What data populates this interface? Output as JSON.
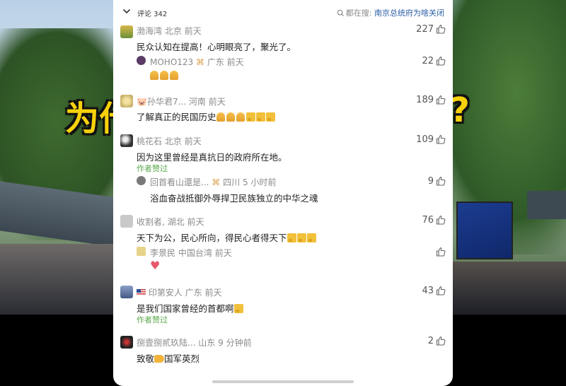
{
  "background": {
    "caption_left": "为什",
    "caption_right": "?"
  },
  "header": {
    "count_label": "评论 342",
    "search_label": "都在搜:",
    "search_term": "南京总统府为啥关闭"
  },
  "comments": [
    {
      "name": "渤海湾",
      "location": "北京",
      "time": "前天",
      "text": "民众认知在提高！心明眼亮了，聚光了。",
      "likes": "227",
      "reply": {
        "name": "MOHO123",
        "location": "广东",
        "time": "前天",
        "likes": "22"
      }
    },
    {
      "name": "🐷孙华君7...",
      "location": "河南",
      "time": "前天",
      "text": "了解真正的民国历史",
      "likes": "189"
    },
    {
      "name": "桃花石",
      "location": "北京",
      "time": "前天",
      "text": "因为这里曾经是真抗日的政府所在地。",
      "likes": "109",
      "author_liked": "作者赞过",
      "reply": {
        "name": "回首看山還是...",
        "location": "四川",
        "time": "5 小时前",
        "text": "浴血奋战抵御外辱捍卫民族独立的中华之魂",
        "likes": "9"
      }
    },
    {
      "name": "收割者,",
      "location": "湖北",
      "time": "前天",
      "text": "天下为公，民心所向，得民心者得天下",
      "likes": "76",
      "reply": {
        "name": "李景民",
        "location": "中国台湾",
        "time": "前天",
        "likes": ""
      }
    },
    {
      "name": "印第安人",
      "location": "广东",
      "time": "前天",
      "text": "是我们国家曾经的首都啊",
      "likes": "43",
      "author_liked": "作者赞过"
    },
    {
      "name": "捌壹捌贰玖陆...",
      "location": "山东",
      "time": "9 分钟前",
      "text": "致敬",
      "text_suffix": "国军英烈",
      "likes": "2"
    }
  ],
  "colors": {
    "accent_link": "#2a5fa8",
    "author_liked": "#5aa84a",
    "caption": "#f7d20a"
  }
}
